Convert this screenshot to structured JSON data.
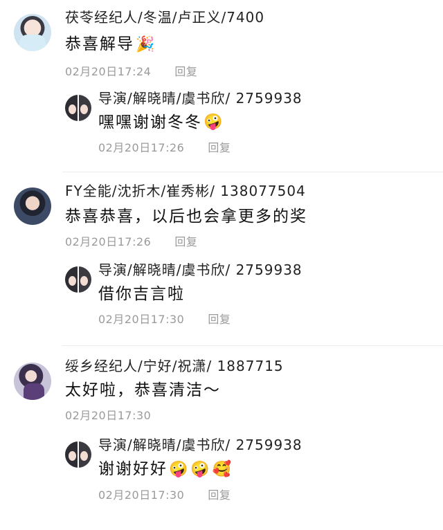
{
  "threads": [
    {
      "comment": {
        "author": "茯苓经纪人/冬温/卢正义/7400",
        "text": "恭喜解导",
        "emojis": [
          "🎉"
        ],
        "time": "02月20日17:24",
        "reply_label": "回复"
      },
      "reply": {
        "author": "导演/解晓晴/虞书欣/ 2759938",
        "text": "嘿嘿谢谢冬冬",
        "emojis": [
          "🤪"
        ],
        "time": "02月20日17:26",
        "reply_label": "回复"
      }
    },
    {
      "comment": {
        "author": "FY全能/沈折木/崔秀彬/ 138077504",
        "text": "恭喜恭喜，以后也会拿更多的奖",
        "emojis": [],
        "time": "02月20日17:26",
        "reply_label": "回复"
      },
      "reply": {
        "author": "导演/解晓晴/虞书欣/ 2759938",
        "text": "借你吉言啦",
        "emojis": [],
        "time": "02月20日17:30",
        "reply_label": "回复"
      }
    },
    {
      "comment": {
        "author": "绥乡经纪人/宁好/祝潇/ 1887715",
        "text": "太好啦，恭喜清洁～",
        "emojis": [],
        "time": "02月20日17:30",
        "reply_label": ""
      },
      "reply": {
        "author": "导演/解晓晴/虞书欣/ 2759938",
        "text": "谢谢好好",
        "emojis": [
          "🤪",
          "🤪",
          "🥰"
        ],
        "time": "02月20日17:30",
        "reply_label": "回复"
      }
    }
  ]
}
